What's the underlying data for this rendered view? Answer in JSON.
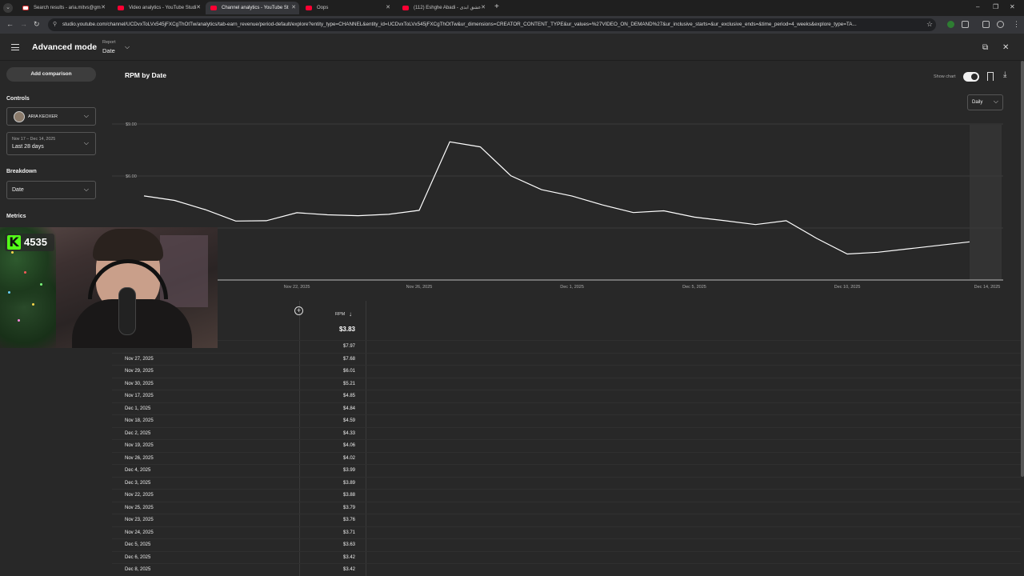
{
  "browser": {
    "tabs": [
      {
        "title": "Search results - aria.mitvs@gm",
        "active": false,
        "icon": "gmail-icon"
      },
      {
        "title": "Video analytics - YouTube Studi",
        "active": false,
        "icon": "youtube-icon"
      },
      {
        "title": "Channel analytics - YouTube St",
        "active": true,
        "icon": "youtube-icon"
      },
      {
        "title": "Oops",
        "active": false,
        "icon": "youtube-icon"
      },
      {
        "title": "(112) Eshghe Abadi - عشق ابدی",
        "active": false,
        "icon": "youtube-icon"
      }
    ],
    "url": "studio.youtube.com/channel/UCDvxToLVx545jFXCgThOtTw/analytics/tab-earn_revenue/period-default/explore?entity_type=CHANNEL&entity_id=UCDvxToLVx545jFXCgThOtTw&ur_dimensions=CREATOR_CONTENT_TYPE&ur_values=%27VIDEO_ON_DEMAND%27&ur_inclusive_starts=&ur_exclusive_ends=&time_period=4_weeks&explore_type=TA..."
  },
  "header": {
    "title": "Advanced mode",
    "report_label": "Report",
    "report_value": "Date"
  },
  "sidebar": {
    "add_comparison": "Add comparison",
    "controls_title": "Controls",
    "channel_name": "ARIA KEOXER",
    "date_range_small": "Nov 17 – Dec 14, 2025",
    "date_range_main": "Last 28 days",
    "breakdown_title": "Breakdown",
    "breakdown_value": "Date",
    "metrics_title": "Metrics"
  },
  "chart": {
    "title": "RPM by Date",
    "show_chart_label": "Show chart",
    "interval": "Daily"
  },
  "chart_data": {
    "type": "line",
    "title": "RPM by Date",
    "x": [
      "Nov 17",
      "Nov 18",
      "Nov 19",
      "Nov 20",
      "Nov 21",
      "Nov 22",
      "Nov 23",
      "Nov 24",
      "Nov 25",
      "Nov 26",
      "Nov 27",
      "Nov 28",
      "Nov 29",
      "Nov 30",
      "Dec 1",
      "Dec 2",
      "Dec 3",
      "Dec 4",
      "Dec 5",
      "Dec 6",
      "Dec 7",
      "Dec 8",
      "Dec 9",
      "Dec 10",
      "Dec 11",
      "Dec 12",
      "Dec 13",
      "Dec 14"
    ],
    "series": [
      {
        "values": [
          4.85,
          4.59,
          4.06,
          3.4,
          3.42,
          3.88,
          3.76,
          3.71,
          3.79,
          4.02,
          7.97,
          7.68,
          6.01,
          5.21,
          4.84,
          4.33,
          3.89,
          3.99,
          3.63,
          3.42,
          3.2,
          3.42,
          2.4,
          1.5,
          1.6,
          1.8,
          2.0,
          2.2
        ]
      }
    ],
    "y_ticks": [
      "$9.00",
      "$6.00"
    ],
    "x_ticks": [
      "Nov 22, 2025",
      "Nov 26, 2025",
      "Dec 1, 2025",
      "Dec 5, 2025",
      "Dec 10, 2025",
      "Dec 14, 2025"
    ],
    "ylim": [
      0,
      9
    ],
    "grid": true
  },
  "table": {
    "metric_header": "RPM",
    "total": "$3.83",
    "rows": [
      {
        "date": "",
        "value": "$7.97"
      },
      {
        "date": "Nov 27, 2025",
        "value": "$7.68"
      },
      {
        "date": "Nov 29, 2025",
        "value": "$6.01"
      },
      {
        "date": "Nov 30, 2025",
        "value": "$5.21"
      },
      {
        "date": "Nov 17, 2025",
        "value": "$4.85"
      },
      {
        "date": "Dec 1, 2025",
        "value": "$4.84"
      },
      {
        "date": "Nov 18, 2025",
        "value": "$4.59"
      },
      {
        "date": "Dec 2, 2025",
        "value": "$4.33"
      },
      {
        "date": "Nov 19, 2025",
        "value": "$4.06"
      },
      {
        "date": "Nov 26, 2025",
        "value": "$4.02"
      },
      {
        "date": "Dec 4, 2025",
        "value": "$3.99"
      },
      {
        "date": "Dec 3, 2025",
        "value": "$3.89"
      },
      {
        "date": "Nov 22, 2025",
        "value": "$3.88"
      },
      {
        "date": "Nov 25, 2025",
        "value": "$3.79"
      },
      {
        "date": "Nov 23, 2025",
        "value": "$3.76"
      },
      {
        "date": "Nov 24, 2025",
        "value": "$3.71"
      },
      {
        "date": "Dec 5, 2025",
        "value": "$3.63"
      },
      {
        "date": "Dec 6, 2025",
        "value": "$3.42"
      },
      {
        "date": "Dec 8, 2025",
        "value": "$3.42"
      }
    ]
  },
  "overlay": {
    "kick_label": "K",
    "viewer_count": "4535"
  },
  "colors": {
    "background": "#282828",
    "line": "#ffffff",
    "kick_green": "#53fc18"
  }
}
